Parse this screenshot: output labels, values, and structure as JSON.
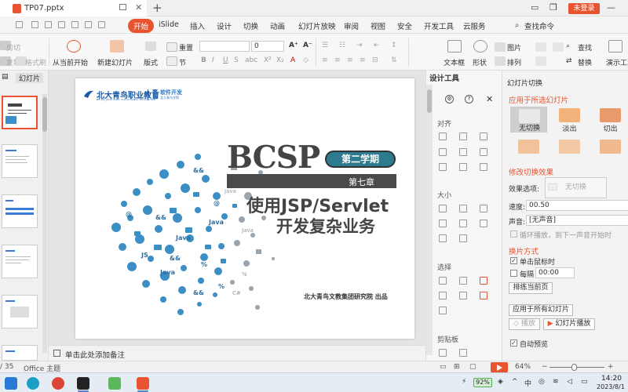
{
  "titlebar": {
    "doc_name": "TP07.pptx",
    "login_label": "未登录"
  },
  "menu": {
    "items": [
      "开始",
      "iSlide",
      "插入",
      "设计",
      "切换",
      "动画",
      "幻灯片放映",
      "审阅",
      "视图",
      "安全",
      "开发工具",
      "云服务"
    ],
    "active": "开始",
    "search_command": "查找命令"
  },
  "ribbon": {
    "cut": "剪切",
    "copy": "复制",
    "format_painter": "格式刷",
    "from_current": "从当前开始",
    "new_slide": "新建幻灯片",
    "layout": "版式",
    "section": "节",
    "reset": "重置",
    "font_size": "0",
    "text_box": "文本框",
    "shape": "形状",
    "arrange": "排列",
    "picture": "图片",
    "find": "查找",
    "replace": "替换",
    "slideshow": "演示工具"
  },
  "left_panel": {
    "tab_slides": "幻灯片",
    "slide_total_label": "/ 35"
  },
  "slide": {
    "logo1_text": "北大青鸟职业教育",
    "logo1_sub": "BEIDA JADE BIRD VOCATIONAL EDUCATION",
    "logo2_text": "软件开发",
    "logo2_sub": "北大青鸟学院",
    "brand": "BCSP",
    "term": "第二学期",
    "chapter": "第七章",
    "title_line1": "使用JSP/Servlet",
    "title_line2": "开发复杂业务",
    "publisher": "北大青鸟文教集团研究院 出品"
  },
  "notes": {
    "placeholder": "单击此处添加备注"
  },
  "design_tools": {
    "title": "设计工具",
    "align": "对齐",
    "size": "大小",
    "select": "选择",
    "clipboard": "剪贴板"
  },
  "transition": {
    "pane_title": "幻灯片切换",
    "apply_selected": "应用于所选幻灯片",
    "tiles": [
      {
        "label": "无切换",
        "color": "#e8e8e8"
      },
      {
        "label": "淡出",
        "color": "#f2b27a"
      },
      {
        "label": "切出",
        "color": "#e99a6a"
      },
      {
        "label": "",
        "color": "#f1c39b"
      },
      {
        "label": "",
        "color": "#f3c9a5"
      },
      {
        "label": "",
        "color": "#efb88d"
      }
    ],
    "modify": "修改切换效果",
    "effect_option_label": "效果选项:",
    "effect_option_value": "无切换",
    "speed_label": "速度:",
    "speed_value": "00.50",
    "sound_label": "声音:",
    "sound_value": "[无声音]",
    "loop": "循环播放，到下一声音开始时",
    "advance": "换片方式",
    "on_click": "单击鼠标时",
    "every_label": "每隔",
    "every_value": "00:00",
    "sort_current": "排练当前页",
    "apply_all": "应用于所有幻灯片",
    "play": "播放",
    "slideshow_play": "幻灯片播放",
    "auto_preview": "自动预览"
  },
  "statusbar": {
    "slide_count": "/ 35",
    "theme": "Office 主题",
    "zoom": "64%"
  },
  "taskbar": {
    "battery": "92%",
    "time": "14:20",
    "date": "2023/8/1"
  }
}
